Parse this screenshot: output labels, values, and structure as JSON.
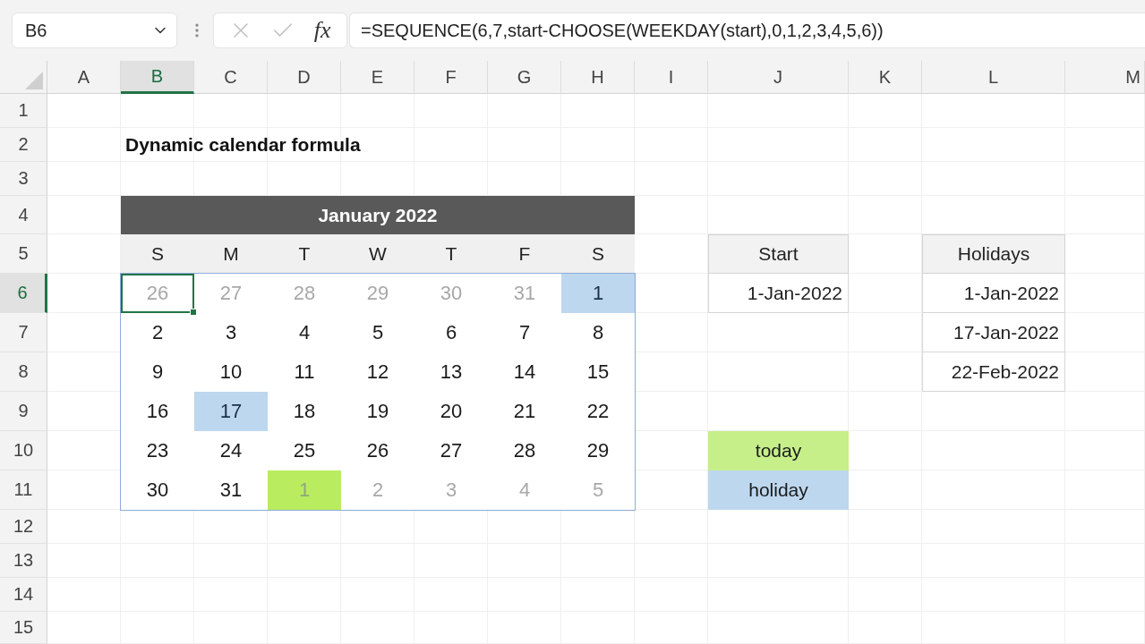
{
  "name_box": {
    "value": "B6"
  },
  "formula_bar": {
    "function_label": "fx",
    "value": "=SEQUENCE(6,7,start-CHOOSE(WEEKDAY(start),0,1,2,3,4,5,6))"
  },
  "column_headers": [
    {
      "label": "A",
      "selected": false
    },
    {
      "label": "B",
      "selected": true
    },
    {
      "label": "C",
      "selected": false
    },
    {
      "label": "D",
      "selected": false
    },
    {
      "label": "E",
      "selected": false
    },
    {
      "label": "F",
      "selected": false
    },
    {
      "label": "G",
      "selected": false
    },
    {
      "label": "H",
      "selected": false
    },
    {
      "label": "I",
      "selected": false
    },
    {
      "label": "J",
      "selected": false
    },
    {
      "label": "K",
      "selected": false
    },
    {
      "label": "L",
      "selected": false
    },
    {
      "label": "M",
      "selected": false
    }
  ],
  "row_headers": [
    {
      "label": "1",
      "selected": false
    },
    {
      "label": "2",
      "selected": false
    },
    {
      "label": "3",
      "selected": false
    },
    {
      "label": "4",
      "selected": false
    },
    {
      "label": "5",
      "selected": false
    },
    {
      "label": "6",
      "selected": true
    },
    {
      "label": "7",
      "selected": false
    },
    {
      "label": "8",
      "selected": false
    },
    {
      "label": "9",
      "selected": false
    },
    {
      "label": "10",
      "selected": false
    },
    {
      "label": "11",
      "selected": false
    },
    {
      "label": "12",
      "selected": false
    },
    {
      "label": "13",
      "selected": false
    },
    {
      "label": "14",
      "selected": false
    },
    {
      "label": "15",
      "selected": false
    }
  ],
  "sheet": {
    "title": "Dynamic calendar formula",
    "calendar": {
      "title": "January 2022",
      "weekdays": [
        "S",
        "M",
        "T",
        "W",
        "T",
        "F",
        "S"
      ],
      "weeks": [
        [
          {
            "day": "26",
            "kind": "plain",
            "muted": true,
            "selected": true
          },
          {
            "day": "27",
            "kind": "plain",
            "muted": true,
            "selected": false
          },
          {
            "day": "28",
            "kind": "plain",
            "muted": true,
            "selected": false
          },
          {
            "day": "29",
            "kind": "plain",
            "muted": true,
            "selected": false
          },
          {
            "day": "30",
            "kind": "plain",
            "muted": true,
            "selected": false
          },
          {
            "day": "31",
            "kind": "plain",
            "muted": true,
            "selected": false
          },
          {
            "day": "1",
            "kind": "holiday",
            "muted": false,
            "selected": false
          }
        ],
        [
          {
            "day": "2",
            "kind": "plain",
            "muted": false,
            "selected": false
          },
          {
            "day": "3",
            "kind": "plain",
            "muted": false,
            "selected": false
          },
          {
            "day": "4",
            "kind": "plain",
            "muted": false,
            "selected": false
          },
          {
            "day": "5",
            "kind": "plain",
            "muted": false,
            "selected": false
          },
          {
            "day": "6",
            "kind": "plain",
            "muted": false,
            "selected": false
          },
          {
            "day": "7",
            "kind": "plain",
            "muted": false,
            "selected": false
          },
          {
            "day": "8",
            "kind": "plain",
            "muted": false,
            "selected": false
          }
        ],
        [
          {
            "day": "9",
            "kind": "plain",
            "muted": false,
            "selected": false
          },
          {
            "day": "10",
            "kind": "plain",
            "muted": false,
            "selected": false
          },
          {
            "day": "11",
            "kind": "plain",
            "muted": false,
            "selected": false
          },
          {
            "day": "12",
            "kind": "plain",
            "muted": false,
            "selected": false
          },
          {
            "day": "13",
            "kind": "plain",
            "muted": false,
            "selected": false
          },
          {
            "day": "14",
            "kind": "plain",
            "muted": false,
            "selected": false
          },
          {
            "day": "15",
            "kind": "plain",
            "muted": false,
            "selected": false
          }
        ],
        [
          {
            "day": "16",
            "kind": "plain",
            "muted": false,
            "selected": false
          },
          {
            "day": "17",
            "kind": "holiday",
            "muted": false,
            "selected": false
          },
          {
            "day": "18",
            "kind": "plain",
            "muted": false,
            "selected": false
          },
          {
            "day": "19",
            "kind": "plain",
            "muted": false,
            "selected": false
          },
          {
            "day": "20",
            "kind": "plain",
            "muted": false,
            "selected": false
          },
          {
            "day": "21",
            "kind": "plain",
            "muted": false,
            "selected": false
          },
          {
            "day": "22",
            "kind": "plain",
            "muted": false,
            "selected": false
          }
        ],
        [
          {
            "day": "23",
            "kind": "plain",
            "muted": false,
            "selected": false
          },
          {
            "day": "24",
            "kind": "plain",
            "muted": false,
            "selected": false
          },
          {
            "day": "25",
            "kind": "plain",
            "muted": false,
            "selected": false
          },
          {
            "day": "26",
            "kind": "plain",
            "muted": false,
            "selected": false
          },
          {
            "day": "27",
            "kind": "plain",
            "muted": false,
            "selected": false
          },
          {
            "day": "28",
            "kind": "plain",
            "muted": false,
            "selected": false
          },
          {
            "day": "29",
            "kind": "plain",
            "muted": false,
            "selected": false
          }
        ],
        [
          {
            "day": "30",
            "kind": "plain",
            "muted": false,
            "selected": false
          },
          {
            "day": "31",
            "kind": "plain",
            "muted": false,
            "selected": false
          },
          {
            "day": "1",
            "kind": "today",
            "muted": true,
            "selected": false
          },
          {
            "day": "2",
            "kind": "plain",
            "muted": true,
            "selected": false
          },
          {
            "day": "3",
            "kind": "plain",
            "muted": true,
            "selected": false
          },
          {
            "day": "4",
            "kind": "plain",
            "muted": true,
            "selected": false
          },
          {
            "day": "5",
            "kind": "plain",
            "muted": true,
            "selected": false
          }
        ]
      ]
    },
    "start_table": {
      "header": "Start",
      "value": "1-Jan-2022"
    },
    "holidays_table": {
      "header": "Holidays",
      "dates": [
        "1-Jan-2022",
        "17-Jan-2022",
        "22-Feb-2022"
      ]
    },
    "legend": [
      {
        "label": "today",
        "color": "#c6ef8a"
      },
      {
        "label": "holiday",
        "color": "#bdd7ee"
      }
    ]
  }
}
